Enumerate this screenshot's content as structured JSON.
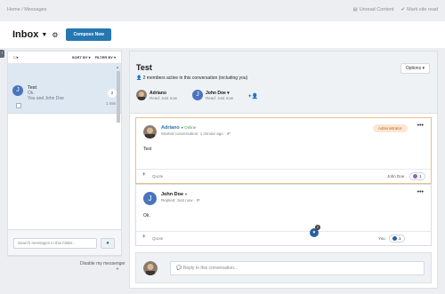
{
  "topbar": {
    "breadcrumb": "Home / Messages",
    "unread_label": "Unread Content",
    "mark_read_label": "Mark site read"
  },
  "header": {
    "title": "Inbox",
    "compose_label": "Compose New"
  },
  "list": {
    "sort_label": "SORT BY",
    "filter_label": "FILTER BY",
    "items": [
      {
        "avatar_letter": "J",
        "title": "Test",
        "last_message": "Ok.",
        "participants": "You and John Doe",
        "reply_count": "2",
        "time": "1 min"
      }
    ],
    "search_placeholder": "Search messages in this folder...",
    "disable_label": "Disable my messenger"
  },
  "conversation": {
    "title": "Test",
    "members_text": "2 members active in this conversation (including you)",
    "options_label": "Options",
    "participants": [
      {
        "name": "Adriano",
        "read": "Read: Just now"
      },
      {
        "name": "John Doe",
        "read": "Read: Just now"
      }
    ],
    "messages": [
      {
        "author": "Adriano",
        "status": "Online",
        "meta": "Started conversation: 1 minute ago · IP",
        "role": "Administrator",
        "body": "Test",
        "quote_label": "Quote",
        "reactor": "John Doe",
        "reaction_count": "1"
      },
      {
        "author": "John Doe",
        "status": "",
        "meta": "Replied: Just now · IP",
        "body": "Ok.",
        "quote_label": "Quote",
        "reactor": "You",
        "reaction_count": "1",
        "badge_count": "2"
      }
    ],
    "reply_placeholder": "Reply to this conversation..."
  },
  "colors": {
    "accent": "#2577b1",
    "selected_row": "#dde8f3",
    "admin_badge_bg": "#fbe7d3",
    "admin_badge_text": "#c1671b",
    "online": "#3a9e3a"
  }
}
